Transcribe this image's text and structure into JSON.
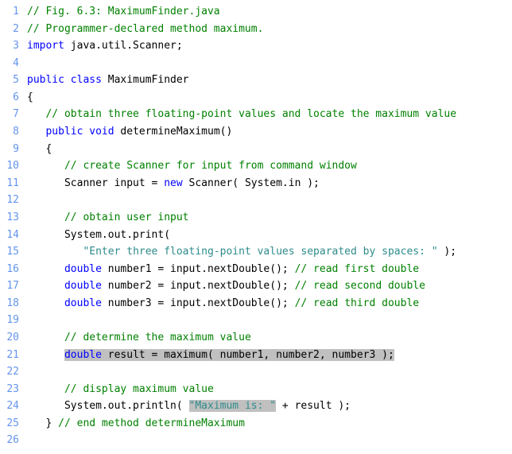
{
  "lines": [
    {
      "n": 1,
      "indent": "",
      "tokens": [
        {
          "t": "// Fig. 6.3: MaximumFinder.java",
          "c": "comment"
        }
      ]
    },
    {
      "n": 2,
      "indent": "",
      "tokens": [
        {
          "t": "// Programmer-declared method maximum.",
          "c": "comment"
        }
      ]
    },
    {
      "n": 3,
      "indent": "",
      "tokens": [
        {
          "t": "import",
          "c": "keyword"
        },
        {
          "t": " java.util.Scanner;",
          "c": ""
        }
      ]
    },
    {
      "n": 4,
      "indent": "",
      "tokens": []
    },
    {
      "n": 5,
      "indent": "",
      "tokens": [
        {
          "t": "public",
          "c": "keyword"
        },
        {
          "t": " ",
          "c": ""
        },
        {
          "t": "class",
          "c": "keyword"
        },
        {
          "t": " MaximumFinder",
          "c": ""
        }
      ]
    },
    {
      "n": 6,
      "indent": "",
      "tokens": [
        {
          "t": "{",
          "c": ""
        }
      ]
    },
    {
      "n": 7,
      "indent": "   ",
      "tokens": [
        {
          "t": "// obtain three floating-point values and locate the maximum value",
          "c": "comment"
        }
      ]
    },
    {
      "n": 8,
      "indent": "   ",
      "tokens": [
        {
          "t": "public",
          "c": "keyword"
        },
        {
          "t": " ",
          "c": ""
        },
        {
          "t": "void",
          "c": "keyword"
        },
        {
          "t": " determineMaximum()",
          "c": ""
        }
      ]
    },
    {
      "n": 9,
      "indent": "   ",
      "tokens": [
        {
          "t": "{",
          "c": ""
        }
      ]
    },
    {
      "n": 10,
      "indent": "      ",
      "tokens": [
        {
          "t": "// create Scanner for input from command window",
          "c": "comment"
        }
      ]
    },
    {
      "n": 11,
      "indent": "      ",
      "tokens": [
        {
          "t": "Scanner input = ",
          "c": ""
        },
        {
          "t": "new",
          "c": "keyword"
        },
        {
          "t": " Scanner( System.in );",
          "c": ""
        }
      ]
    },
    {
      "n": 12,
      "indent": "",
      "tokens": []
    },
    {
      "n": 13,
      "indent": "      ",
      "tokens": [
        {
          "t": "// obtain user input",
          "c": "comment"
        }
      ]
    },
    {
      "n": 14,
      "indent": "      ",
      "tokens": [
        {
          "t": "System.out.print(",
          "c": ""
        }
      ]
    },
    {
      "n": 15,
      "indent": "         ",
      "tokens": [
        {
          "t": "\"Enter three floating-point values separated by spaces: \"",
          "c": "string"
        },
        {
          "t": " );",
          "c": ""
        }
      ]
    },
    {
      "n": 16,
      "indent": "      ",
      "tokens": [
        {
          "t": "double",
          "c": "keyword"
        },
        {
          "t": " number1 = input.nextDouble(); ",
          "c": ""
        },
        {
          "t": "// read first double",
          "c": "comment"
        }
      ]
    },
    {
      "n": 17,
      "indent": "      ",
      "tokens": [
        {
          "t": "double",
          "c": "keyword"
        },
        {
          "t": " number2 = input.nextDouble(); ",
          "c": ""
        },
        {
          "t": "// read second double",
          "c": "comment"
        }
      ]
    },
    {
      "n": 18,
      "indent": "      ",
      "tokens": [
        {
          "t": "double",
          "c": "keyword"
        },
        {
          "t": " number3 = input.nextDouble(); ",
          "c": ""
        },
        {
          "t": "// read third double",
          "c": "comment"
        }
      ]
    },
    {
      "n": 19,
      "indent": "",
      "tokens": []
    },
    {
      "n": 20,
      "indent": "      ",
      "tokens": [
        {
          "t": "// determine the maximum value",
          "c": "comment"
        }
      ]
    },
    {
      "n": 21,
      "indent": "      ",
      "tokens": [
        {
          "t": "double",
          "c": "keyword",
          "hl": true
        },
        {
          "t": " result = maximum( number1, number2, number3 );",
          "c": "",
          "hl": true
        }
      ]
    },
    {
      "n": 22,
      "indent": "",
      "tokens": []
    },
    {
      "n": 23,
      "indent": "      ",
      "tokens": [
        {
          "t": "// display maximum value",
          "c": "comment"
        }
      ]
    },
    {
      "n": 24,
      "indent": "      ",
      "tokens": [
        {
          "t": "System.out.println( ",
          "c": ""
        },
        {
          "t": "\"Maximum is: \"",
          "c": "string",
          "hl": true
        },
        {
          "t": " + result );",
          "c": ""
        }
      ]
    },
    {
      "n": 25,
      "indent": "   ",
      "tokens": [
        {
          "t": "} ",
          "c": ""
        },
        {
          "t": "// end method determineMaximum",
          "c": "comment"
        }
      ]
    },
    {
      "n": 26,
      "indent": "",
      "tokens": []
    }
  ]
}
